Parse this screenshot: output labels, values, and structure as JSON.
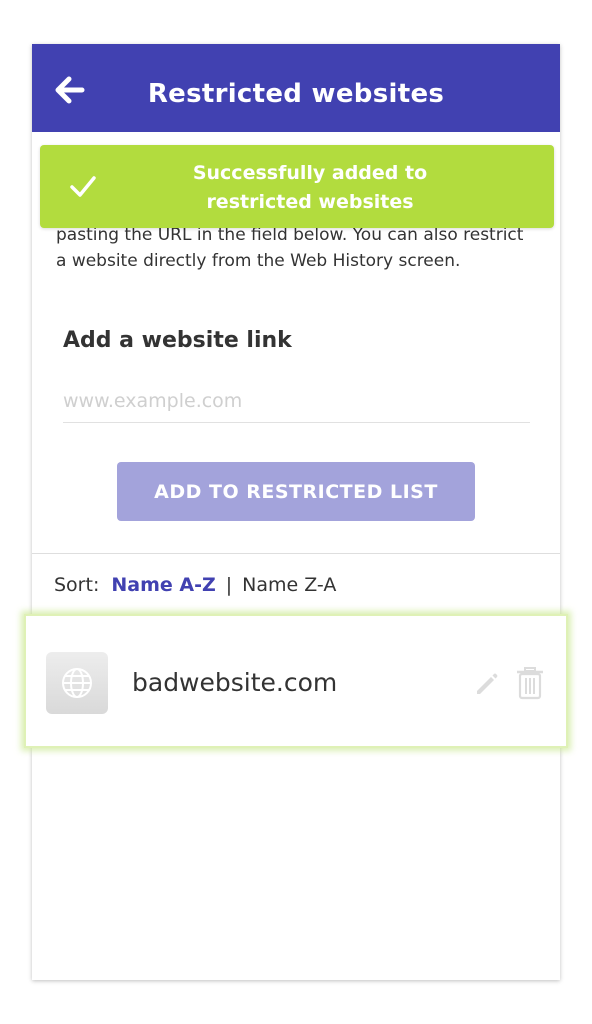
{
  "colors": {
    "primary": "#4141b1",
    "toast": "#b2dc3e",
    "button": "#a3a3db",
    "highlight": "#dff1b6"
  },
  "header": {
    "title": "Restricted websites",
    "back_icon": "arrow-left-icon"
  },
  "toast": {
    "icon": "checkmark-icon",
    "line1": "Successfully added to",
    "line2": "restricted websites"
  },
  "intro": {
    "text": "pasting the URL in the field below. You can also restrict a website directly from the Web History screen."
  },
  "form": {
    "label": "Add a website link",
    "placeholder": "www.example.com",
    "button_label": "ADD TO RESTRICTED LIST"
  },
  "sort": {
    "label": "Sort:",
    "active": "Name A-Z",
    "separator": "|",
    "inactive": "Name Z-A"
  },
  "list": {
    "items": [
      {
        "icon": "globe-icon",
        "name": "badwebsite.com",
        "edit_icon": "pencil-icon",
        "delete_icon": "trash-icon"
      }
    ]
  }
}
